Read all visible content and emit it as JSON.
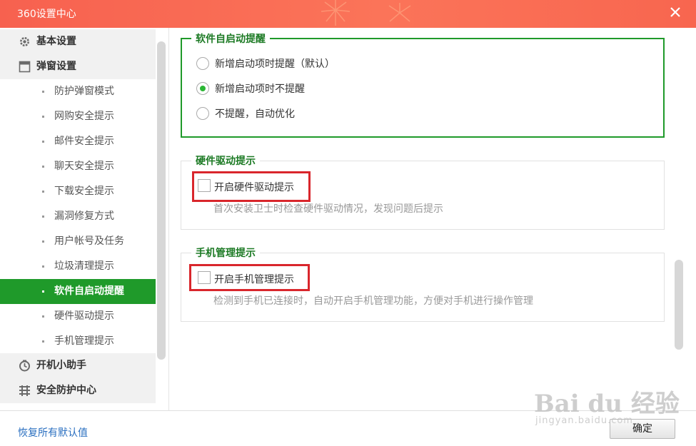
{
  "window": {
    "title": "360设置中心",
    "close_icon": "close-icon"
  },
  "sidebar": {
    "groups": [
      {
        "label": "基本设置",
        "icon": "gear-icon"
      },
      {
        "label": "弹窗设置",
        "icon": "window-icon"
      },
      {
        "label": "开机小助手",
        "icon": "clock-icon"
      },
      {
        "label": "安全防护中心",
        "icon": "grid-icon"
      }
    ],
    "sub_items": [
      "防护弹窗模式",
      "网购安全提示",
      "邮件安全提示",
      "聊天安全提示",
      "下载安全提示",
      "漏洞修复方式",
      "用户帐号及任务",
      "垃圾清理提示",
      "软件自启动提醒",
      "硬件驱动提示",
      "手机管理提示"
    ],
    "active_item": "软件自启动提醒"
  },
  "main": {
    "startup_section": {
      "title": "软件自启动提醒",
      "options": [
        {
          "label": "新增启动项时提醒（默认）",
          "checked": false
        },
        {
          "label": "新增启动项时不提醒",
          "checked": true
        },
        {
          "label": "不提醒，自动优化",
          "checked": false
        }
      ]
    },
    "hardware_section": {
      "title": "硬件驱动提示",
      "checkbox_label": "开启硬件驱动提示",
      "checked": false,
      "description": "首次安装卫士时检查硬件驱动情况，发现问题后提示"
    },
    "phone_section": {
      "title": "手机管理提示",
      "checkbox_label": "开启手机管理提示",
      "checked": false,
      "description": "检测到手机已连接时，自动开启手机管理功能，方便对手机进行操作管理"
    }
  },
  "footer": {
    "restore_label": "恢复所有默认值",
    "ok_label": "确定"
  },
  "watermark": {
    "main": "Bai du 经验",
    "sub": "jingyan.baidu.com"
  },
  "colors": {
    "titlebar": "#f86a52",
    "accent_green": "#1f9a2a",
    "legend_green": "#1c7a24",
    "highlight_red": "#d9262c",
    "link_blue": "#2a6fc0"
  }
}
